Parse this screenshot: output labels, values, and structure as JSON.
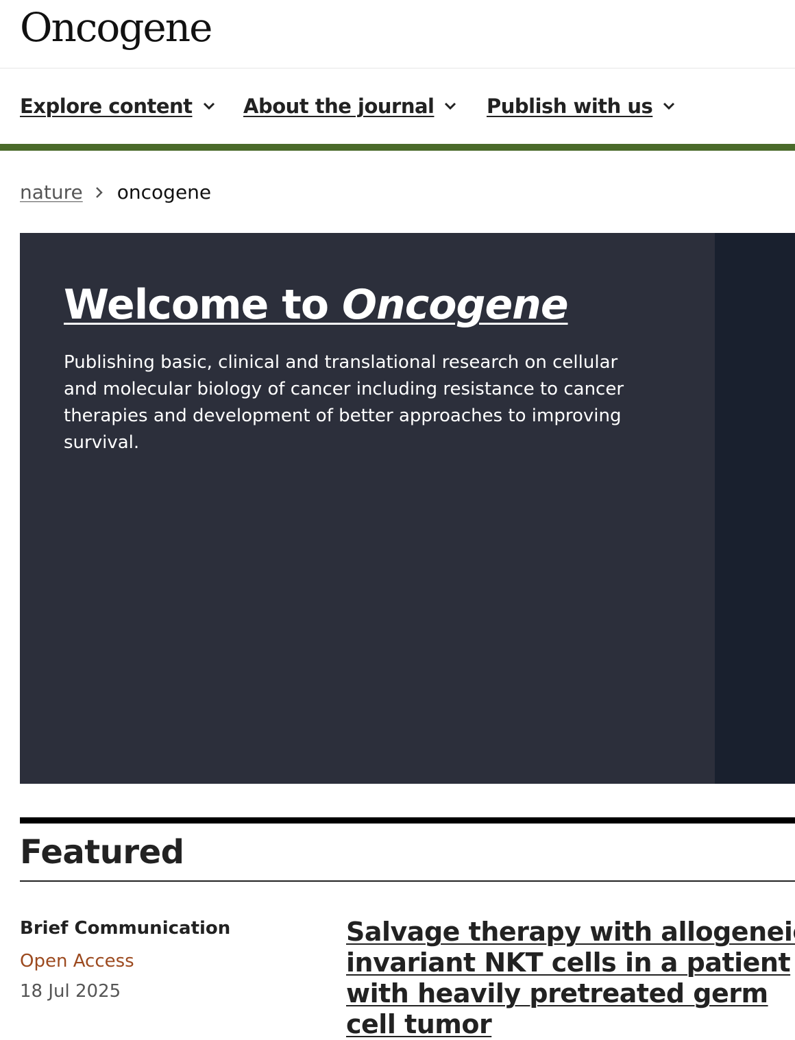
{
  "header": {
    "logo": "Oncogene"
  },
  "nav": {
    "items": [
      {
        "label": "Explore content"
      },
      {
        "label": "About the journal"
      },
      {
        "label": "Publish with us"
      }
    ]
  },
  "colors": {
    "accent_bar": "#4a6a2a",
    "hero_background": "#2c2f3b",
    "open_access": "#9c4a1f"
  },
  "breadcrumb": {
    "root": "nature",
    "current": "oncogene"
  },
  "hero": {
    "title_prefix": "Welcome to ",
    "title_emphasis": "Oncogene",
    "description": "Publishing basic, clinical and translational research on cellular and molecular biology of cancer including resistance to cancer therapies and development of better approaches to improving survival."
  },
  "featured": {
    "heading": "Featured",
    "article": {
      "type": "Brief Communication",
      "access": "Open Access",
      "date": "18 Jul 2025",
      "title": "Salvage therapy with allogeneic invariant NKT cells in a patient with heavily pretreated germ cell tumor"
    }
  }
}
